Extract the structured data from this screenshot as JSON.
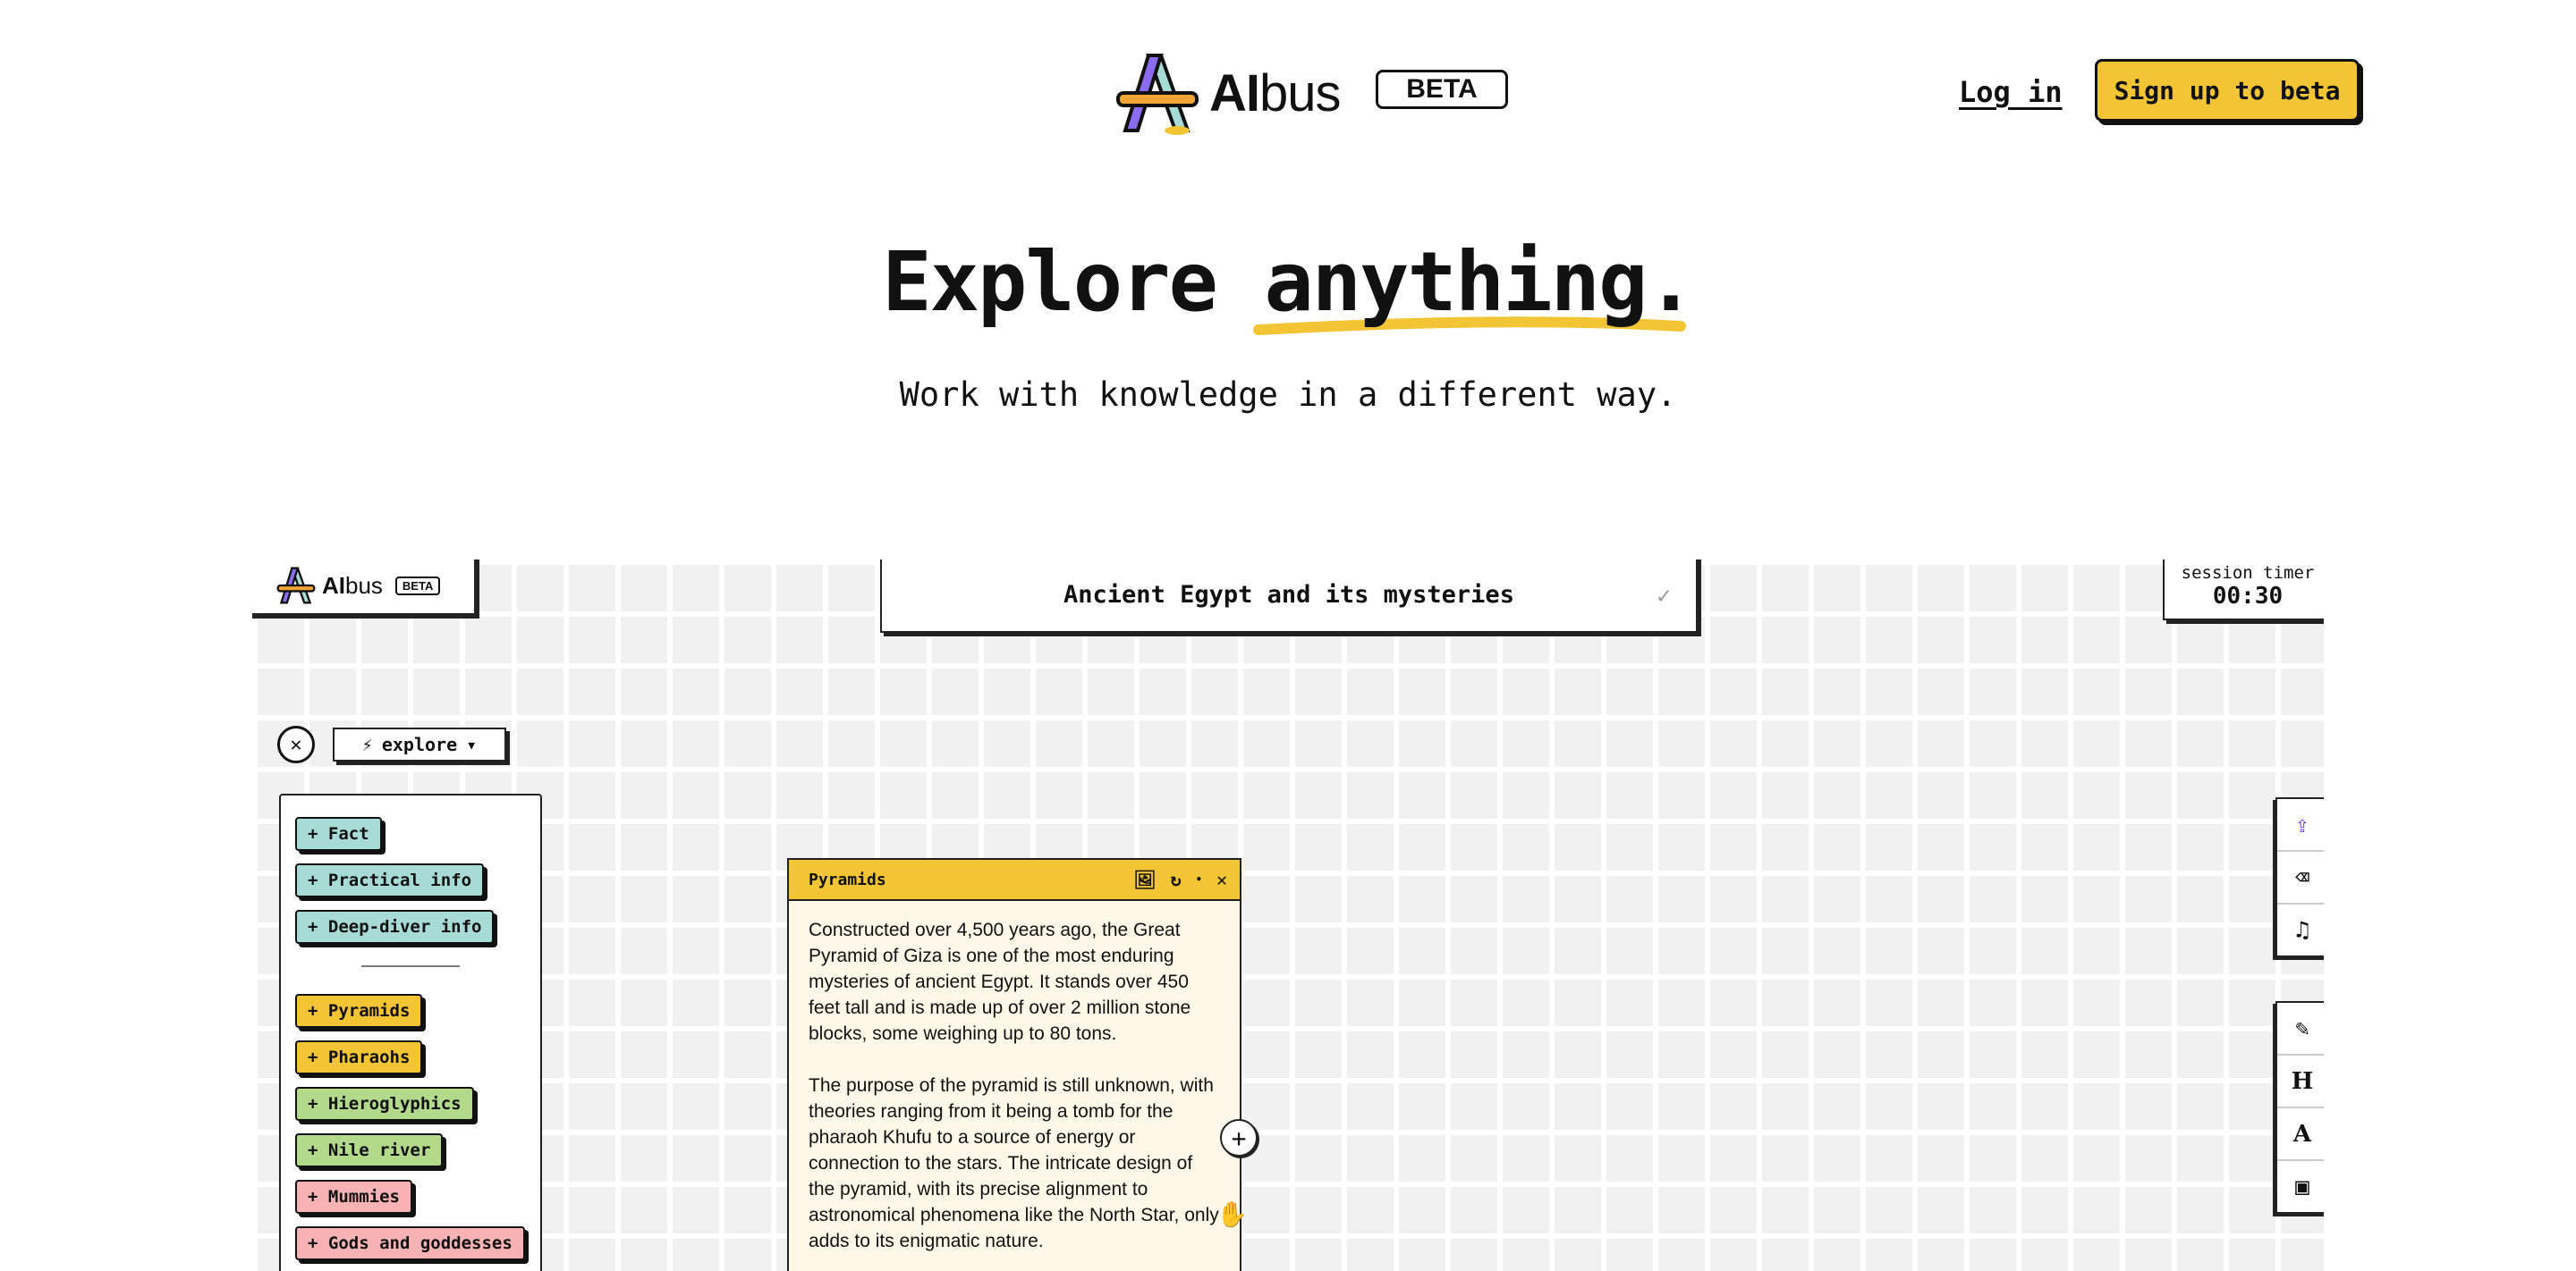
{
  "header": {
    "brand_bold": "AI",
    "brand_light": "bus",
    "beta": "BETA",
    "login": "Log in",
    "signup": "Sign up to beta"
  },
  "hero": {
    "title_plain": "Explore",
    "title_highlight": "anything.",
    "subtitle": "Work with knowledge in a different way."
  },
  "demo": {
    "brand_bold": "AI",
    "brand_light": "bus",
    "beta": "BETA",
    "topic": "Ancient Egypt and its mysteries",
    "timer_label": "session timer",
    "timer_value": "00:30",
    "mode": "explore",
    "info_chips": [
      "+ Fact",
      "+ Practical info",
      "+ Deep-diver info"
    ],
    "topic_chips": [
      "+ Pyramids",
      "+ Pharaohs",
      "+ Hieroglyphics",
      "+ Nile river",
      "+ Mummies",
      "+ Gods and goddesses"
    ],
    "card": {
      "title": "Pyramids",
      "paragraphs": [
        "Constructed over 4,500 years ago, the Great Pyramid of Giza is one of the most enduring mysteries of ancient Egypt. It stands over 450 feet tall and is made up of over 2 million stone blocks, some weighing up to 80 tons.",
        "The purpose of the pyramid is still unknown, with theories ranging from it being a tomb for the pharaoh Khufu to a source of energy or connection to the stars. The intricate design of the pyramid, with its precise alignment to astronomical phenomena like the North Star, only adds to its enigmatic nature."
      ]
    },
    "tools_top": [
      "share-icon",
      "eraser-icon",
      "music-icon"
    ],
    "tools_bottom": {
      "wand": "magic-wand-icon",
      "heading": "H",
      "text": "A",
      "image": "image-icon"
    }
  },
  "colors": {
    "accent": "#f3c433",
    "teal": "#a7dcd6",
    "green": "#b3d98a",
    "pink": "#f7b3b3",
    "purple": "#6a35e0"
  }
}
